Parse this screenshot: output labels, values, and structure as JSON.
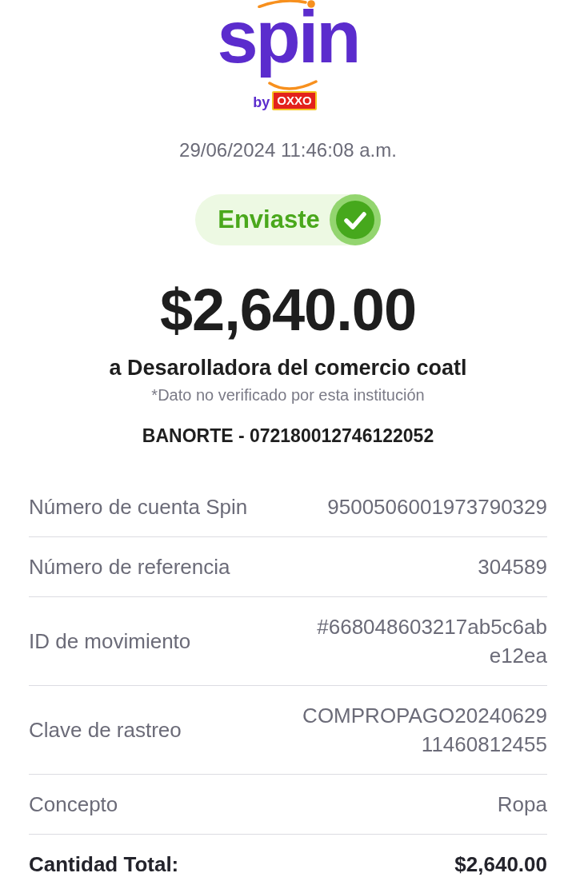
{
  "logo": {
    "name": "spin",
    "by": "by",
    "partner": "OXXO"
  },
  "date": "29/06/2024 11:46:08 a.m.",
  "status": {
    "label": "Enviaste"
  },
  "amount": "$2,640.00",
  "recipient": "a Desarolladora del comercio coatl",
  "note": "*Dato no verificado por esta institución",
  "bank_account": "BANORTE - 072180012746122052",
  "details": [
    {
      "label": "Número de cuenta Spin",
      "value": [
        "9500506001973790329"
      ]
    },
    {
      "label": "Número de referencia",
      "value": [
        "304589"
      ]
    },
    {
      "label": "ID de movimiento",
      "value": [
        "#668048603217ab5c6ab",
        "e12ea"
      ]
    },
    {
      "label": "Clave de rastreo",
      "value": [
        "COMPROPAGO20240629",
        "11460812455"
      ]
    },
    {
      "label": "Concepto",
      "value": [
        "Ropa"
      ]
    }
  ],
  "total": {
    "label": "Cantidad Total:",
    "value": "$2,640.00"
  }
}
